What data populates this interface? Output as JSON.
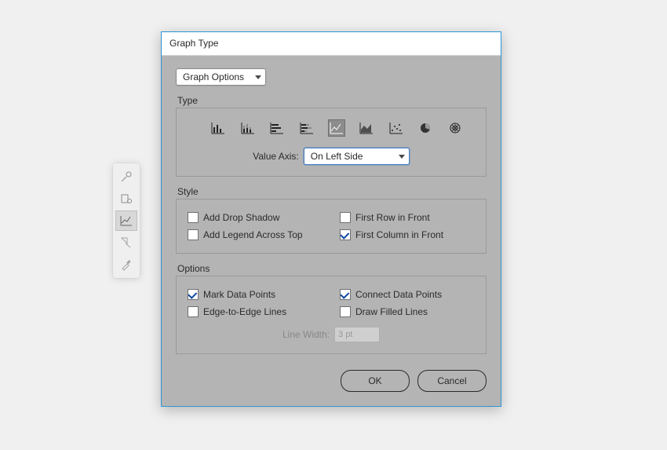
{
  "dialog": {
    "title": "Graph Type",
    "category_select": "Graph Options",
    "type": {
      "label": "Type",
      "value_axis_label": "Value Axis:",
      "value_axis_value": "On Left Side"
    },
    "style": {
      "label": "Style",
      "add_drop_shadow": "Add Drop Shadow",
      "add_legend_across_top": "Add Legend Across Top",
      "first_row_in_front": "First Row in Front",
      "first_column_in_front": "First Column in Front"
    },
    "options": {
      "label": "Options",
      "mark_data_points": "Mark Data Points",
      "edge_to_edge_lines": "Edge-to-Edge Lines",
      "connect_data_points": "Connect Data Points",
      "draw_filled_lines": "Draw Filled Lines",
      "line_width_label": "Line Width:",
      "line_width_value": "3 pt"
    },
    "buttons": {
      "ok": "OK",
      "cancel": "Cancel"
    }
  },
  "graph_icons": [
    "column-graph",
    "stacked-column-graph",
    "bar-graph",
    "stacked-bar-graph",
    "line-graph",
    "area-graph",
    "scatter-graph",
    "pie-graph",
    "radar-graph"
  ],
  "selected_graph_icon": 4,
  "palette_tools": [
    "poll-tool",
    "perspective-grid-tool",
    "line-graph-tool",
    "slice-tool",
    "eyedropper-tool"
  ],
  "selected_palette_tool": 2
}
